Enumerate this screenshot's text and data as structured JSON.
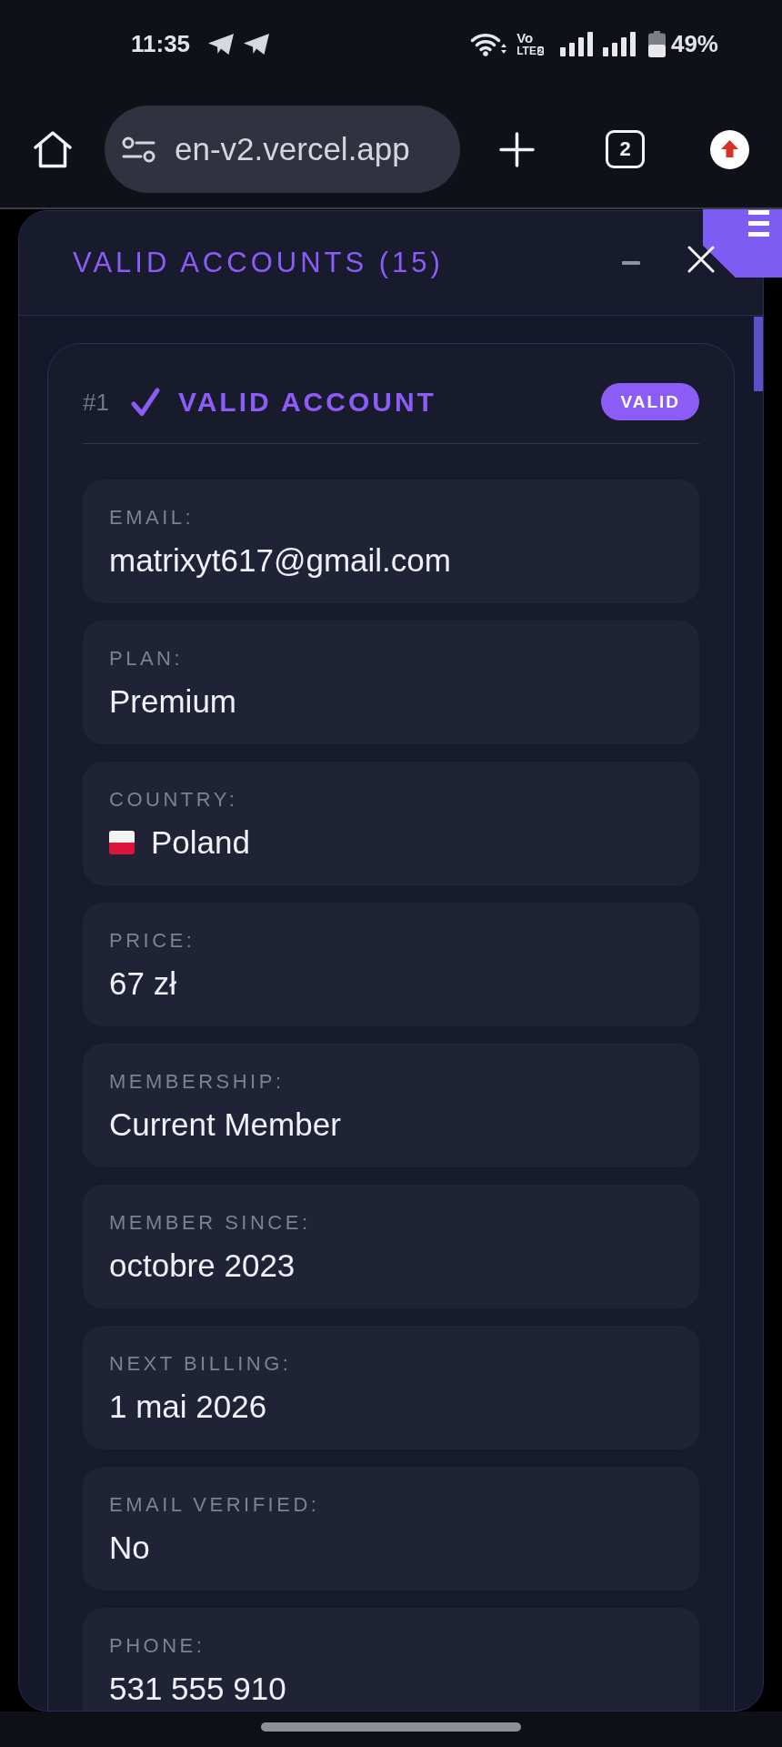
{
  "status_bar": {
    "time": "11:35",
    "volte": "Vo",
    "network": "LTE",
    "sim": "2",
    "battery": "49%"
  },
  "browser": {
    "url": "en-v2.vercel.app",
    "tab_count": "2"
  },
  "panel": {
    "title": "VALID ACCOUNTS (15)",
    "card": {
      "number": "#1",
      "title": "VALID ACCOUNT",
      "badge": "VALID",
      "fields": [
        {
          "kind": "text",
          "label": "EMAIL:",
          "value": "matrixyt617@gmail.com"
        },
        {
          "kind": "text",
          "label": "PLAN:",
          "value": "Premium"
        },
        {
          "kind": "country",
          "label": "COUNTRY:",
          "value": "Poland"
        },
        {
          "kind": "text",
          "label": "PRICE:",
          "value": "67 zł"
        },
        {
          "kind": "text",
          "label": "MEMBERSHIP:",
          "value": "Current Member"
        },
        {
          "kind": "text",
          "label": "MEMBER SINCE:",
          "value": "octobre 2023"
        },
        {
          "kind": "text",
          "label": "NEXT BILLING:",
          "value": "1 mai 2026"
        },
        {
          "kind": "text",
          "label": "EMAIL VERIFIED:",
          "value": "No"
        },
        {
          "kind": "text",
          "label": "PHONE:",
          "value": "531 555 910"
        }
      ]
    }
  }
}
